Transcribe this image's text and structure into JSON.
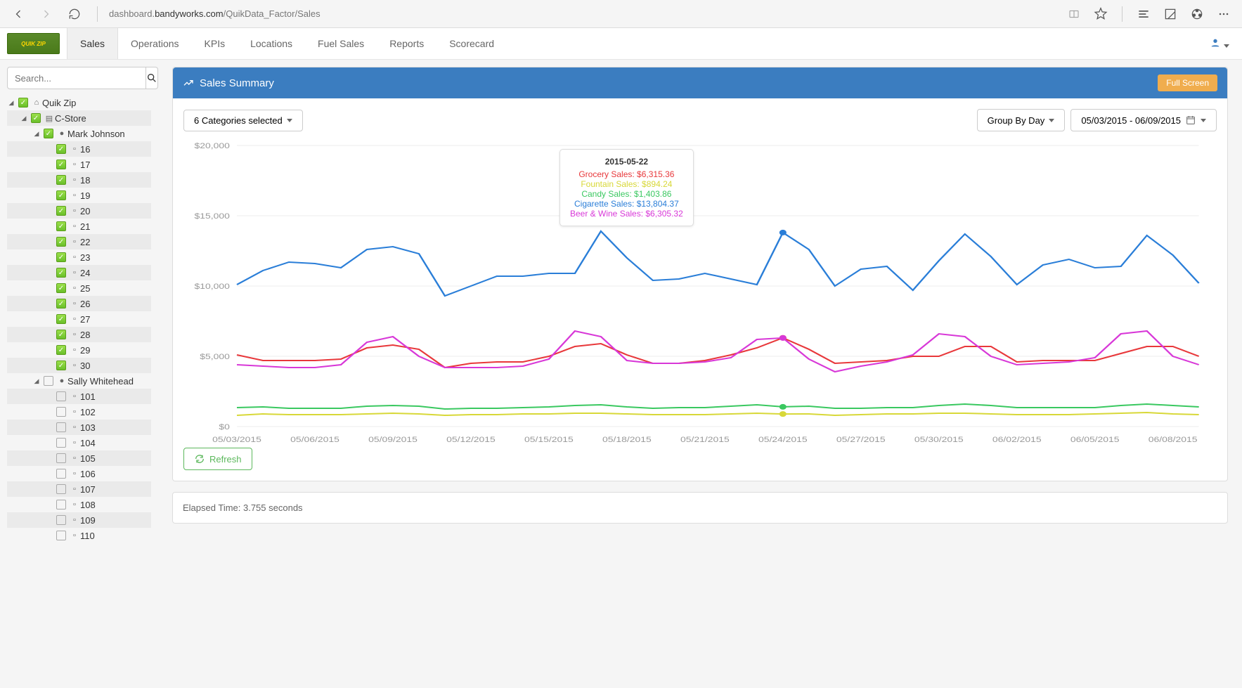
{
  "browser": {
    "url_pre": "dashboard.",
    "url_bold": "bandyworks.com",
    "url_post": "/QuikData_Factor/Sales"
  },
  "logo": "QUIK ZIP",
  "nav": [
    "Sales",
    "Operations",
    "KPIs",
    "Locations",
    "Fuel Sales",
    "Reports",
    "Scorecard"
  ],
  "search": {
    "placeholder": "Search..."
  },
  "tree": {
    "root": "Quik Zip",
    "group": "C-Store",
    "mgr1": "Mark Johnson",
    "stores1": [
      "16",
      "17",
      "18",
      "19",
      "20",
      "21",
      "22",
      "23",
      "24",
      "25",
      "26",
      "27",
      "28",
      "29",
      "30"
    ],
    "mgr2": "Sally Whitehead",
    "stores2": [
      "101",
      "102",
      "103",
      "104",
      "105",
      "106",
      "107",
      "108",
      "109",
      "110"
    ]
  },
  "panel": {
    "title": "Sales Summary",
    "fullscreen": "Full Screen",
    "categories": "6 Categories selected",
    "groupby": "Group By Day",
    "daterange": "05/03/2015 - 06/09/2015",
    "refresh": "Refresh"
  },
  "tooltip": {
    "date": "2015-05-22",
    "lines": [
      {
        "label": "Grocery Sales: $6,315.36",
        "cls": "tt-red"
      },
      {
        "label": "Fountain Sales: $894.24",
        "cls": "tt-yellow"
      },
      {
        "label": "Candy Sales: $1,403.86",
        "cls": "tt-green"
      },
      {
        "label": "Cigarette Sales: $13,804.37",
        "cls": "tt-blue"
      },
      {
        "label": "Beer & Wine Sales: $6,305.32",
        "cls": "tt-magenta"
      }
    ]
  },
  "status": "Elapsed Time: 3.755 seconds",
  "chart_data": {
    "type": "line",
    "title": "Sales Summary",
    "xlabel": "",
    "ylabel": "",
    "ylim": [
      0,
      20000
    ],
    "yticks": [
      0,
      5000,
      10000,
      15000,
      20000
    ],
    "ytick_labels": [
      "$0",
      "$5,000",
      "$10,000",
      "$15,000",
      "$20,000"
    ],
    "x": [
      "05/03/2015",
      "05/04/2015",
      "05/05/2015",
      "05/06/2015",
      "05/07/2015",
      "05/08/2015",
      "05/09/2015",
      "05/10/2015",
      "05/11/2015",
      "05/12/2015",
      "05/13/2015",
      "05/14/2015",
      "05/15/2015",
      "05/16/2015",
      "05/17/2015",
      "05/18/2015",
      "05/19/2015",
      "05/20/2015",
      "05/21/2015",
      "05/22/2015",
      "05/23/2015",
      "05/24/2015",
      "05/25/2015",
      "05/26/2015",
      "05/27/2015",
      "05/28/2015",
      "05/29/2015",
      "05/30/2015",
      "05/31/2015",
      "06/01/2015",
      "06/02/2015",
      "06/03/2015",
      "06/04/2015",
      "06/05/2015",
      "06/06/2015",
      "06/07/2015",
      "06/08/2015",
      "06/09/2015"
    ],
    "xtick_labels": [
      "05/03/2015",
      "05/06/2015",
      "05/09/2015",
      "05/12/2015",
      "05/15/2015",
      "05/18/2015",
      "05/21/2015",
      "05/24/2015",
      "05/27/2015",
      "05/30/2015",
      "06/02/2015",
      "06/05/2015",
      "06/08/2015"
    ],
    "series": [
      {
        "name": "Cigarette Sales",
        "color": "#2a7ed8",
        "values": [
          10100,
          11100,
          11700,
          11600,
          11300,
          12600,
          12800,
          12300,
          9300,
          10000,
          10700,
          10700,
          10900,
          10900,
          13900,
          12000,
          10400,
          10500,
          10900,
          10500,
          10100,
          13804,
          12600,
          10000,
          11200,
          11400,
          9700,
          11800,
          13700,
          12100,
          10100,
          11500,
          11900,
          11300,
          11400,
          13600,
          12200,
          10200
        ]
      },
      {
        "name": "Grocery Sales",
        "color": "#e8383b",
        "values": [
          5100,
          4700,
          4700,
          4700,
          4800,
          5600,
          5800,
          5500,
          4200,
          4500,
          4600,
          4600,
          5000,
          5700,
          5900,
          5100,
          4500,
          4500,
          4700,
          5100,
          5600,
          6315,
          5500,
          4500,
          4600,
          4700,
          5000,
          5000,
          5700,
          5700,
          4600,
          4700,
          4700,
          4700,
          5200,
          5700,
          5700,
          5000
        ]
      },
      {
        "name": "Beer & Wine Sales",
        "color": "#d838d8",
        "values": [
          4400,
          4300,
          4200,
          4200,
          4400,
          6000,
          6400,
          5000,
          4200,
          4200,
          4200,
          4300,
          4800,
          6800,
          6400,
          4700,
          4500,
          4500,
          4600,
          4900,
          6200,
          6305,
          4800,
          3900,
          4300,
          4600,
          5100,
          6600,
          6400,
          5000,
          4400,
          4500,
          4600,
          4900,
          6600,
          6800,
          5000,
          4400
        ]
      },
      {
        "name": "Candy Sales",
        "color": "#3ac860",
        "values": [
          1350,
          1400,
          1300,
          1300,
          1300,
          1450,
          1500,
          1450,
          1250,
          1300,
          1300,
          1350,
          1400,
          1500,
          1550,
          1400,
          1300,
          1350,
          1350,
          1450,
          1550,
          1404,
          1450,
          1300,
          1300,
          1350,
          1350,
          1500,
          1600,
          1500,
          1350,
          1350,
          1350,
          1350,
          1500,
          1600,
          1500,
          1400
        ]
      },
      {
        "name": "Fountain Sales",
        "color": "#d8d838",
        "values": [
          800,
          900,
          850,
          850,
          850,
          900,
          950,
          900,
          800,
          850,
          850,
          900,
          900,
          950,
          950,
          900,
          850,
          850,
          850,
          900,
          950,
          894,
          900,
          800,
          850,
          900,
          900,
          950,
          950,
          900,
          850,
          850,
          850,
          900,
          950,
          1000,
          900,
          850
        ]
      }
    ],
    "highlight_index": 21
  }
}
